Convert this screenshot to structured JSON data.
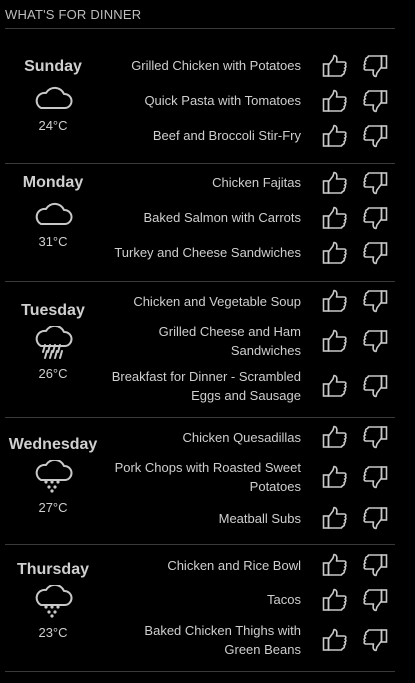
{
  "header": {
    "title": "WHAT'S FOR DINNER"
  },
  "colors": {
    "background": "#000000",
    "text": "#cfcfcf",
    "divider": "#3a3a3a"
  },
  "days": [
    {
      "name": "Sunday",
      "weather_icon": "cloudy-icon",
      "temp": "24°C",
      "meals": [
        "Grilled Chicken with Potatoes",
        "Quick Pasta with Tomatoes",
        "Beef and Broccoli Stir-Fry"
      ]
    },
    {
      "name": "Monday",
      "weather_icon": "cloudy-icon",
      "temp": "31°C",
      "meals": [
        "Chicken Fajitas",
        "Baked Salmon with Carrots",
        "Turkey and Cheese Sandwiches"
      ]
    },
    {
      "name": "Tuesday",
      "weather_icon": "rain-icon",
      "temp": "26°C",
      "meals": [
        "Chicken and Vegetable Soup",
        "Grilled Cheese and Ham Sandwiches",
        "Breakfast for Dinner - Scrambled Eggs and Sausage"
      ]
    },
    {
      "name": "Wednesday",
      "weather_icon": "showers-icon",
      "temp": "27°C",
      "meals": [
        "Chicken Quesadillas",
        "Pork Chops with Roasted Sweet Potatoes",
        "Meatball Subs"
      ]
    },
    {
      "name": "Thursday",
      "weather_icon": "showers-icon",
      "temp": "23°C",
      "meals": [
        "Chicken and Rice Bowl",
        "Tacos",
        "Baked Chicken Thighs with Green Beans"
      ]
    }
  ]
}
